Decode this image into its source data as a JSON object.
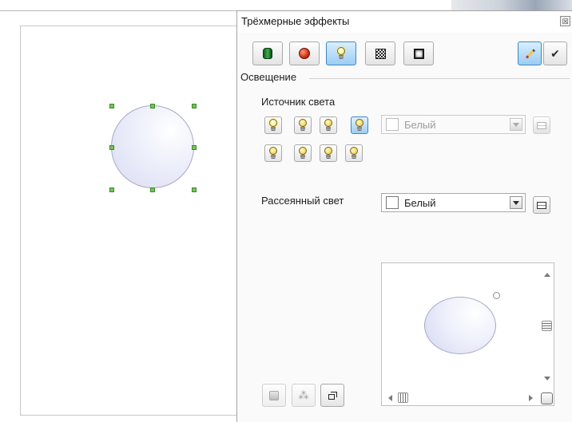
{
  "dialog": {
    "title": "Трёхмерные эффекты",
    "close_glyph": "☒"
  },
  "toolbar": {
    "buttons": [
      {
        "name": "geometry",
        "icon": "cylinder-icon",
        "active": false
      },
      {
        "name": "shading",
        "icon": "sphere-icon",
        "active": false
      },
      {
        "name": "illumination",
        "icon": "light-bulb-icon",
        "active": true
      },
      {
        "name": "textures",
        "icon": "checker-texture-icon",
        "active": false
      },
      {
        "name": "material",
        "icon": "material-icon",
        "active": false
      }
    ],
    "update_icon": "pencil-icon",
    "assign_glyph": "✔"
  },
  "lighting": {
    "section_label": "Освещение",
    "light_source_label": "Источник света",
    "light_source_color": "Белый",
    "ambient_label": "Рассеянный свет",
    "ambient_color": "Белый",
    "swatch_color": "#FFFFFF"
  },
  "colors": {
    "accent": "#3F87C6",
    "selection_handle": "#73C456",
    "sphere_fill": "#E8EAFA"
  },
  "bottom_tools": [
    {
      "name": "convert-to-3d",
      "icon": "convert-3d-icon",
      "enabled": false
    },
    {
      "name": "perspective",
      "icon": "perspective-icon",
      "glyph": "⁂",
      "enabled": false
    },
    {
      "name": "3d-object",
      "icon": "cube-outline-icon",
      "enabled": true
    }
  ]
}
